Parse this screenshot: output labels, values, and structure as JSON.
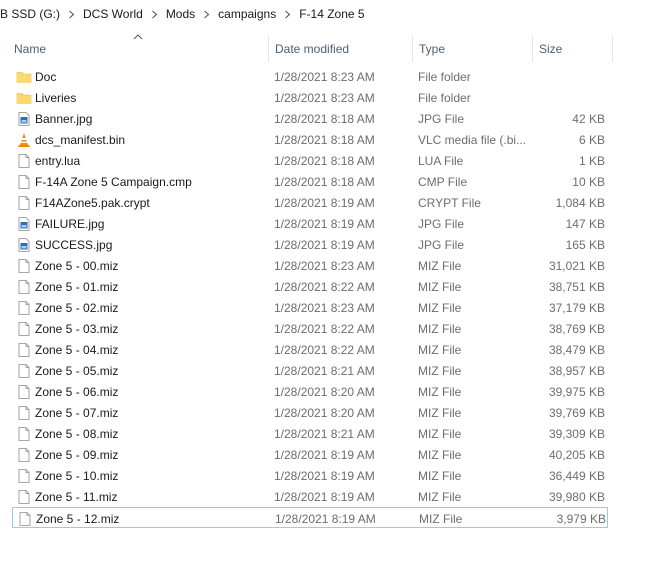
{
  "breadcrumb": [
    "B SSD (G:)",
    "DCS World",
    "Mods",
    "campaigns",
    "F-14 Zone 5"
  ],
  "columns": {
    "name": "Name",
    "date": "Date modified",
    "type": "Type",
    "size": "Size"
  },
  "files": [
    {
      "name": "Doc",
      "date": "1/28/2021 8:23 AM",
      "type": "File folder",
      "size": "",
      "icon": "folder-icon"
    },
    {
      "name": "Liveries",
      "date": "1/28/2021 8:23 AM",
      "type": "File folder",
      "size": "",
      "icon": "folder-icon"
    },
    {
      "name": "Banner.jpg",
      "date": "1/28/2021 8:18 AM",
      "type": "JPG File",
      "size": "42 KB",
      "icon": "image-file-icon"
    },
    {
      "name": "dcs_manifest.bin",
      "date": "1/28/2021 8:18 AM",
      "type": "VLC media file (.bi...",
      "size": "6 KB",
      "icon": "vlc-cone-icon"
    },
    {
      "name": "entry.lua",
      "date": "1/28/2021 8:18 AM",
      "type": "LUA File",
      "size": "1 KB",
      "icon": "document-icon"
    },
    {
      "name": "F-14A Zone 5 Campaign.cmp",
      "date": "1/28/2021 8:18 AM",
      "type": "CMP File",
      "size": "10 KB",
      "icon": "document-icon"
    },
    {
      "name": "F14AZone5.pak.crypt",
      "date": "1/28/2021 8:19 AM",
      "type": "CRYPT File",
      "size": "1,084 KB",
      "icon": "document-icon"
    },
    {
      "name": "FAILURE.jpg",
      "date": "1/28/2021 8:19 AM",
      "type": "JPG File",
      "size": "147 KB",
      "icon": "image-file-icon"
    },
    {
      "name": "SUCCESS.jpg",
      "date": "1/28/2021 8:19 AM",
      "type": "JPG File",
      "size": "165 KB",
      "icon": "image-file-icon"
    },
    {
      "name": "Zone 5 - 00.miz",
      "date": "1/28/2021 8:23 AM",
      "type": "MIZ File",
      "size": "31,021 KB",
      "icon": "document-icon"
    },
    {
      "name": "Zone 5 - 01.miz",
      "date": "1/28/2021 8:22 AM",
      "type": "MIZ File",
      "size": "38,751 KB",
      "icon": "document-icon"
    },
    {
      "name": "Zone 5 - 02.miz",
      "date": "1/28/2021 8:23 AM",
      "type": "MIZ File",
      "size": "37,179 KB",
      "icon": "document-icon"
    },
    {
      "name": "Zone 5 - 03.miz",
      "date": "1/28/2021 8:22 AM",
      "type": "MIZ File",
      "size": "38,769 KB",
      "icon": "document-icon"
    },
    {
      "name": "Zone 5 - 04.miz",
      "date": "1/28/2021 8:22 AM",
      "type": "MIZ File",
      "size": "38,479 KB",
      "icon": "document-icon"
    },
    {
      "name": "Zone 5 - 05.miz",
      "date": "1/28/2021 8:21 AM",
      "type": "MIZ File",
      "size": "38,957 KB",
      "icon": "document-icon"
    },
    {
      "name": "Zone 5 - 06.miz",
      "date": "1/28/2021 8:20 AM",
      "type": "MIZ File",
      "size": "39,975 KB",
      "icon": "document-icon"
    },
    {
      "name": "Zone 5 - 07.miz",
      "date": "1/28/2021 8:20 AM",
      "type": "MIZ File",
      "size": "39,769 KB",
      "icon": "document-icon"
    },
    {
      "name": "Zone 5 - 08.miz",
      "date": "1/28/2021 8:21 AM",
      "type": "MIZ File",
      "size": "39,309 KB",
      "icon": "document-icon"
    },
    {
      "name": "Zone 5 - 09.miz",
      "date": "1/28/2021 8:19 AM",
      "type": "MIZ File",
      "size": "40,205 KB",
      "icon": "document-icon"
    },
    {
      "name": "Zone 5 - 10.miz",
      "date": "1/28/2021 8:19 AM",
      "type": "MIZ File",
      "size": "36,449 KB",
      "icon": "document-icon"
    },
    {
      "name": "Zone 5 - 11.miz",
      "date": "1/28/2021 8:19 AM",
      "type": "MIZ File",
      "size": "39,980 KB",
      "icon": "document-icon"
    },
    {
      "name": "Zone 5 - 12.miz",
      "date": "1/28/2021 8:19 AM",
      "type": "MIZ File",
      "size": "3,979 KB",
      "icon": "document-icon",
      "selected": true
    }
  ],
  "colors": {
    "header_text": "#4c607a",
    "folder": "#f8d775",
    "selection_border": "#99c9ef"
  }
}
